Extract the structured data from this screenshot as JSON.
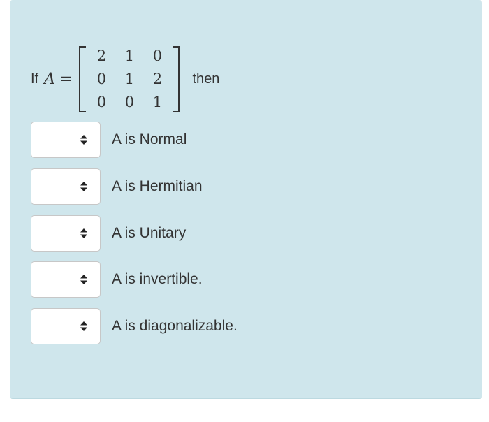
{
  "question": {
    "prefix": "If",
    "variable": "A",
    "equals": "=",
    "suffix": "then",
    "matrix": [
      [
        "2",
        "1",
        "0"
      ],
      [
        "0",
        "1",
        "2"
      ],
      [
        "0",
        "0",
        "1"
      ]
    ]
  },
  "items": [
    {
      "label": "A is Normal",
      "selected": ""
    },
    {
      "label": "A is Hermitian",
      "selected": ""
    },
    {
      "label": "A is Unitary",
      "selected": ""
    },
    {
      "label": "A is invertible.",
      "selected": ""
    },
    {
      "label": "A is diagonalizable.",
      "selected": ""
    }
  ],
  "colors": {
    "panel_background": "#cfe6ec",
    "text": "#333333",
    "select_border": "#c7c7c7"
  },
  "icons": {
    "select_arrow": "up-down-caret-icon"
  }
}
